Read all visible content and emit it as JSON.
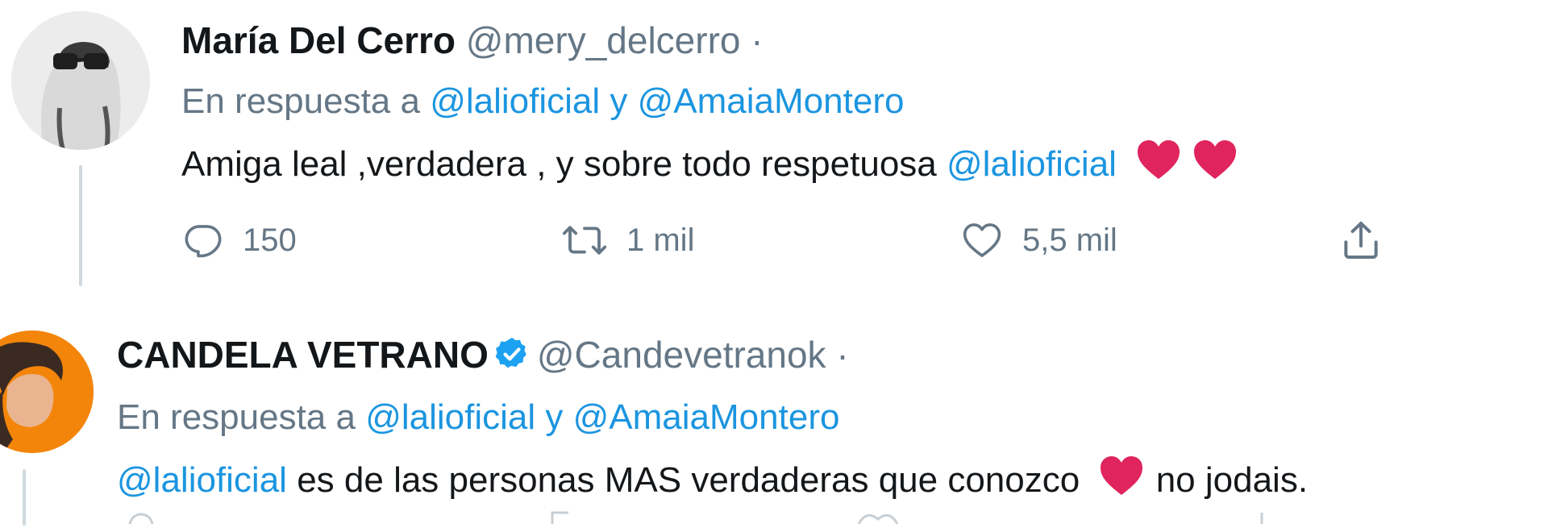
{
  "tweets": [
    {
      "author_name": "María Del Cerro",
      "handle": "@mery_delcerro",
      "separator": "·",
      "reply_prefix": "En respuesta a",
      "reply_mention_1": "@lalioficial",
      "reply_joiner": "y",
      "reply_mention_2": "@AmaiaMontero",
      "text_before": "Amiga leal ,verdadera , y sobre todo respetuosa",
      "text_mention": "@lalioficial",
      "emoji": "heart-emoji",
      "actions": {
        "reply_count": "150",
        "retweet_count": "1 mil",
        "like_count": "5,5 mil"
      }
    },
    {
      "author_name": "CANDELA VETRANO",
      "verified": true,
      "handle": "@Candevetranok",
      "separator": "·",
      "reply_prefix": "En respuesta a",
      "reply_mention_1": "@lalioficial",
      "reply_joiner": "y",
      "reply_mention_2": "@AmaiaMontero",
      "text_mention": "@lalioficial",
      "text_middle": "es de las personas MAS verdaderas que conozco",
      "emoji": "heart-emoji",
      "text_after": "no jodais."
    }
  ],
  "colors": {
    "text": "#14171a",
    "secondary": "#657786",
    "link": "#1b95e0",
    "verified": "#1da1f2",
    "heart": "#e0245e"
  }
}
